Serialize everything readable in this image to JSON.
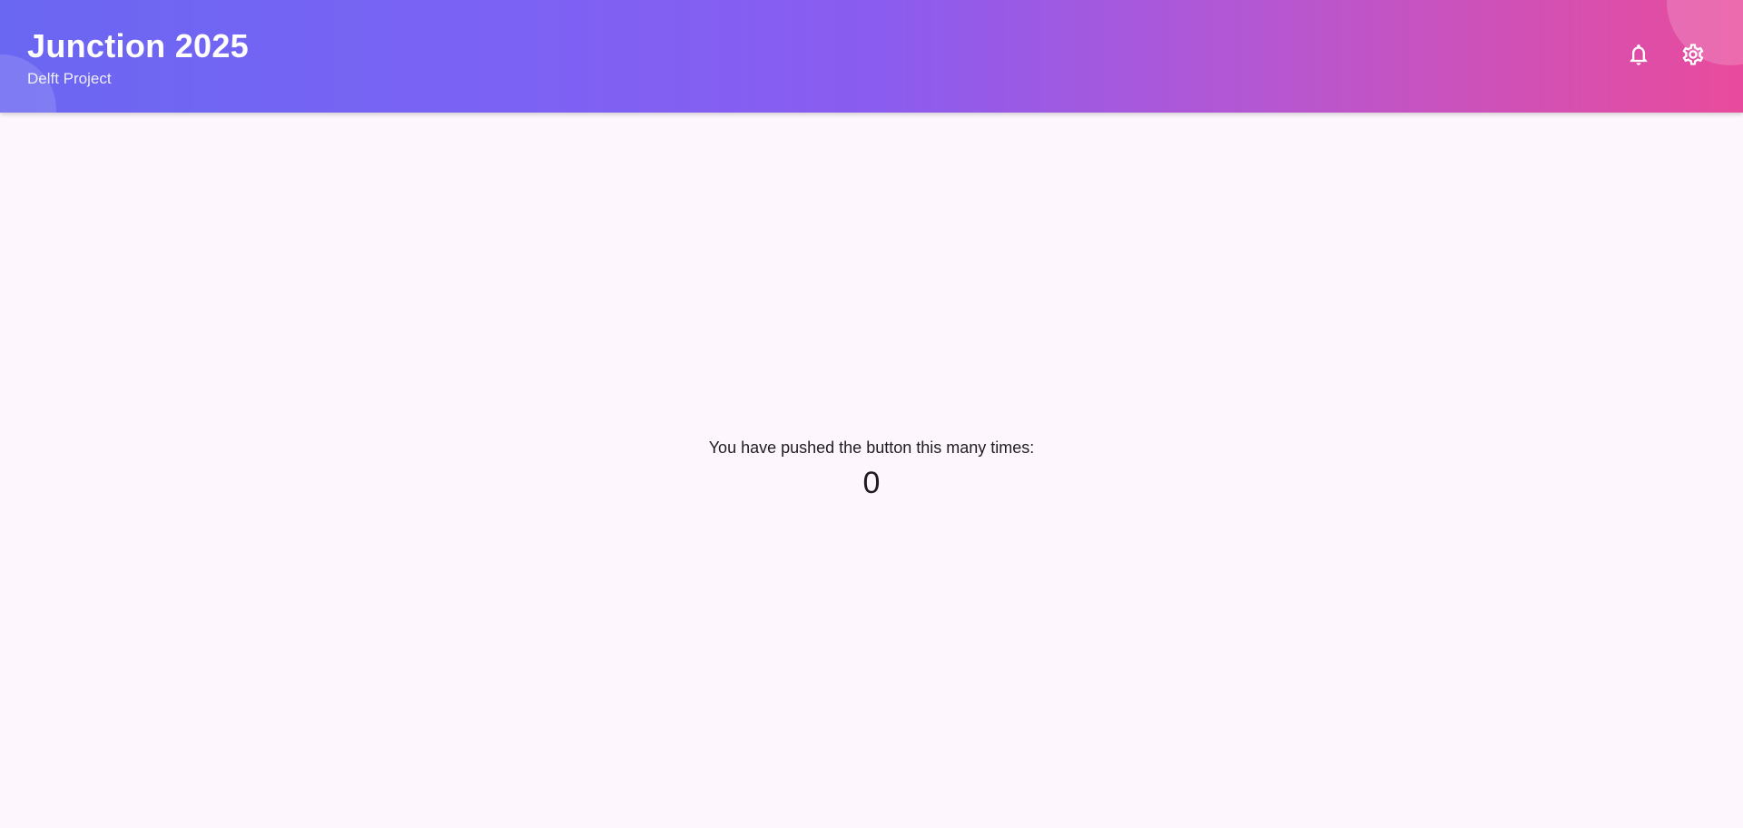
{
  "app_bar": {
    "title": "Junction 2025",
    "subtitle": "Delft Project",
    "gradient_colors": [
      "#6a67f2",
      "#8a5cf0",
      "#b457d3",
      "#e94b9c"
    ],
    "actions": [
      {
        "icon": "bell-icon",
        "label": "Notifications"
      },
      {
        "icon": "gear-icon",
        "label": "Settings"
      }
    ]
  },
  "main": {
    "counter_label": "You have pushed the button this many times:",
    "counter_value": "0"
  },
  "colors": {
    "background": "#fdf7fd",
    "text": "#1f1b22"
  }
}
